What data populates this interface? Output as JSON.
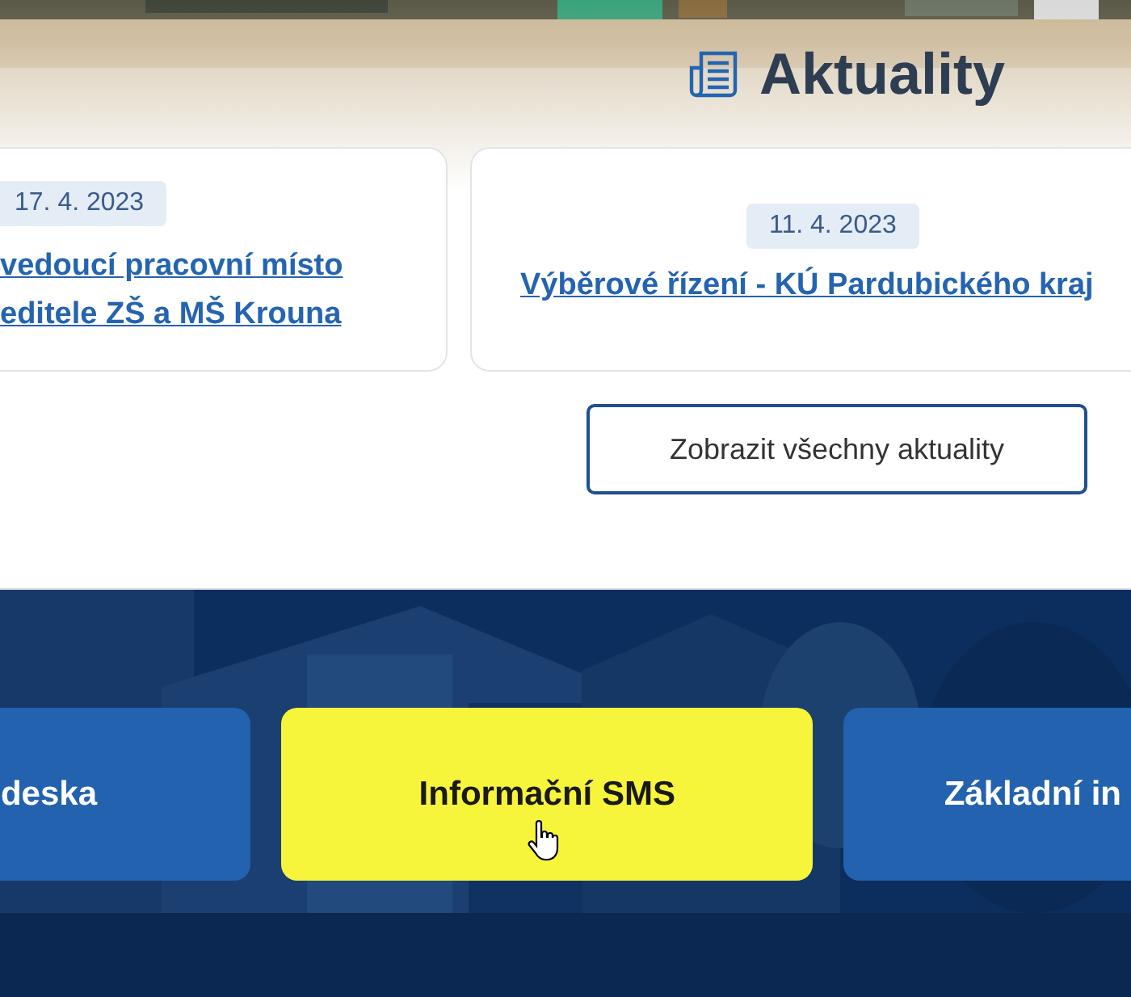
{
  "news": {
    "title": "Aktuality",
    "articles": [
      {
        "date": "17. 4. 2023",
        "title_lines": [
          "vedoucí pracovní místo",
          "editele ZŠ a MŠ Krouna"
        ]
      },
      {
        "date": "11. 4. 2023",
        "title_lines": [
          "Výběrové řízení - KÚ Pardubického kraj"
        ]
      }
    ],
    "show_all": "Zobrazit všechny aktuality"
  },
  "quick_links": [
    {
      "label": "deska",
      "hovered": false
    },
    {
      "label": "Informační SMS",
      "hovered": true
    },
    {
      "label": "Základní in",
      "hovered": false
    }
  ]
}
